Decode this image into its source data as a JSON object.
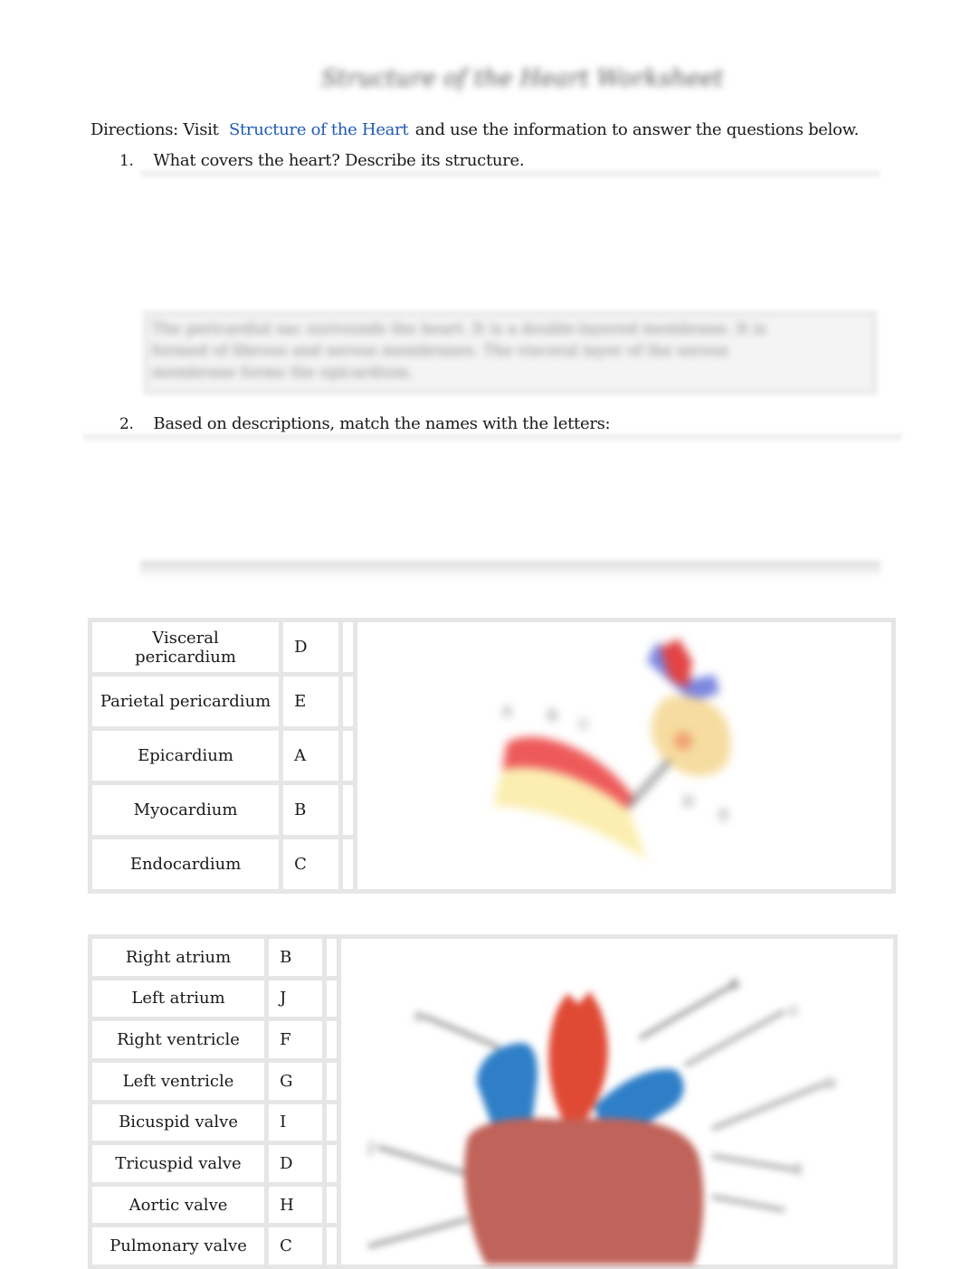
{
  "document": {
    "title": "Structure of the Heart Worksheet",
    "directions_prefix": "Directions: Visit",
    "directions_link": "Structure of the Heart",
    "directions_suffix": "and use the information to answer the questions below.",
    "link_color": "#1f5bb5"
  },
  "questions": [
    {
      "number": "1.",
      "text": "What covers the heart? Describe its structure.",
      "answer": "The pericardial sac surrounds the heart. It is a double-layered membrane. It is formed of fibrous and serous membranes. The visceral layer of the serous membrane forms the epicardium."
    },
    {
      "number": "2.",
      "text": "Based on descriptions, match the names with the letters:"
    }
  ],
  "table1": {
    "rows": [
      {
        "name": "Visceral pericardium",
        "letter": "D"
      },
      {
        "name": "Parietal pericardium",
        "letter": "E"
      },
      {
        "name": "Epicardium",
        "letter": "A"
      },
      {
        "name": "Myocardium",
        "letter": "B"
      },
      {
        "name": "Endocardium",
        "letter": "C"
      }
    ],
    "figure": "heart-wall-layers-diagram"
  },
  "table2": {
    "rows": [
      {
        "name": "Right atrium",
        "letter": "B"
      },
      {
        "name": "Left atrium",
        "letter": "J"
      },
      {
        "name": "Right ventricle",
        "letter": "F"
      },
      {
        "name": "Left ventricle",
        "letter": "G"
      },
      {
        "name": "Bicuspid valve",
        "letter": "I"
      },
      {
        "name": "Tricuspid valve",
        "letter": "D"
      },
      {
        "name": "Aortic valve",
        "letter": "H"
      },
      {
        "name": "Pulmonary valve",
        "letter": "C"
      }
    ],
    "figure": "heart-anatomy-diagram"
  }
}
